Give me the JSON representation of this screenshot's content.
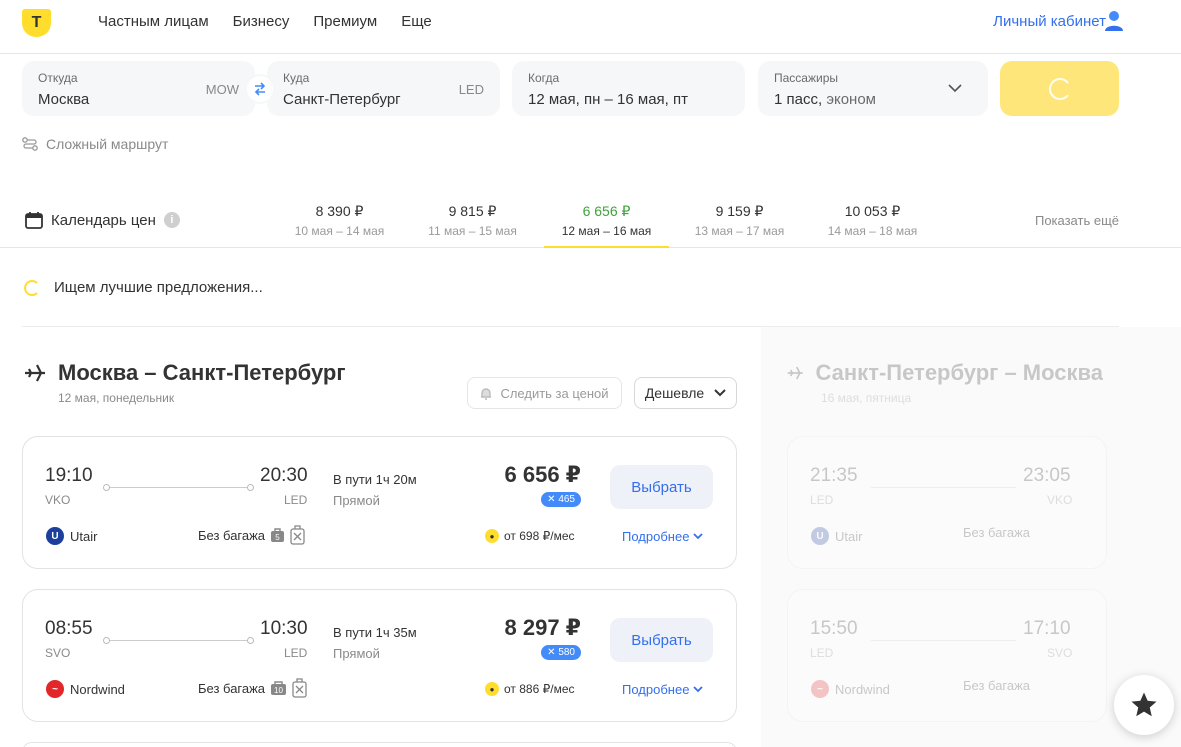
{
  "nav": {
    "logo": "Т",
    "links": [
      "Частным лицам",
      "Бизнесу",
      "Премиум",
      "Еще"
    ],
    "cabinet": "Личный кабинет"
  },
  "search": {
    "from": {
      "label": "Откуда",
      "value": "Москва",
      "code": "MOW"
    },
    "to": {
      "label": "Куда",
      "value": "Санкт-Петербург",
      "code": "LED"
    },
    "when": {
      "label": "Когда",
      "value": "12 мая, пн – 16 мая, пт"
    },
    "passengers": {
      "label": "Пассажиры",
      "value": "1 пасс,",
      "cabin": " эконом"
    },
    "complex_route": "Сложный маршрут"
  },
  "calendar": {
    "label": "Календарь цен",
    "show_more": "Показать ещё",
    "options": [
      {
        "price": "8 390 ₽",
        "dates": "10 мая – 14 мая"
      },
      {
        "price": "9 815 ₽",
        "dates": "11 мая – 15 мая"
      },
      {
        "price": "6 656 ₽",
        "dates": "12 мая – 16 мая"
      },
      {
        "price": "9 159 ₽",
        "dates": "13 мая – 17 мая"
      },
      {
        "price": "10 053 ₽",
        "dates": "14 мая – 18 мая"
      }
    ]
  },
  "status": {
    "searching": "Ищем лучшие предложения..."
  },
  "outbound": {
    "title": "Москва – Санкт-Петербург",
    "date": "12 мая, понедельник",
    "follow_price": "Следить за ценой",
    "sort": "Дешевле",
    "flights": [
      {
        "dep_time": "19:10",
        "dep_ap": "VKO",
        "arr_time": "20:30",
        "arr_ap": "LED",
        "duration": "В пути 1ч 20м",
        "stops": "Прямой",
        "price": "6 656 ₽",
        "cashback": "465",
        "airline": "Utair",
        "baggage": "Без багажа",
        "bag_num": "5",
        "installment": "от 698 ₽/мес",
        "choose": "Выбрать",
        "more": "Подробнее"
      },
      {
        "dep_time": "08:55",
        "dep_ap": "SVO",
        "arr_time": "10:30",
        "arr_ap": "LED",
        "duration": "В пути 1ч 35м",
        "stops": "Прямой",
        "price": "8 297 ₽",
        "cashback": "580",
        "airline": "Nordwind",
        "baggage": "Без багажа",
        "bag_num": "10",
        "installment": "от 886 ₽/мес",
        "choose": "Выбрать",
        "more": "Подробнее"
      }
    ]
  },
  "return": {
    "title": "Санкт-Петербург – Москва",
    "date": "16 мая, пятница",
    "flights": [
      {
        "dep_time": "21:35",
        "dep_ap": "LED",
        "arr_time": "23:05",
        "arr_ap": "VKO",
        "airline": "Utair",
        "baggage": "Без багажа",
        "bag_num": "5"
      },
      {
        "dep_time": "15:50",
        "dep_ap": "LED",
        "arr_time": "17:10",
        "arr_ap": "SVO",
        "airline": "Nordwind",
        "baggage": "Без багажа",
        "bag_num": "10"
      }
    ]
  },
  "colors": {
    "brand_yellow": "#ffdd2d",
    "link_blue": "#336fee",
    "price_green": "#3da33d",
    "utair": "#1d3f9c",
    "nordwind": "#e3262a"
  }
}
